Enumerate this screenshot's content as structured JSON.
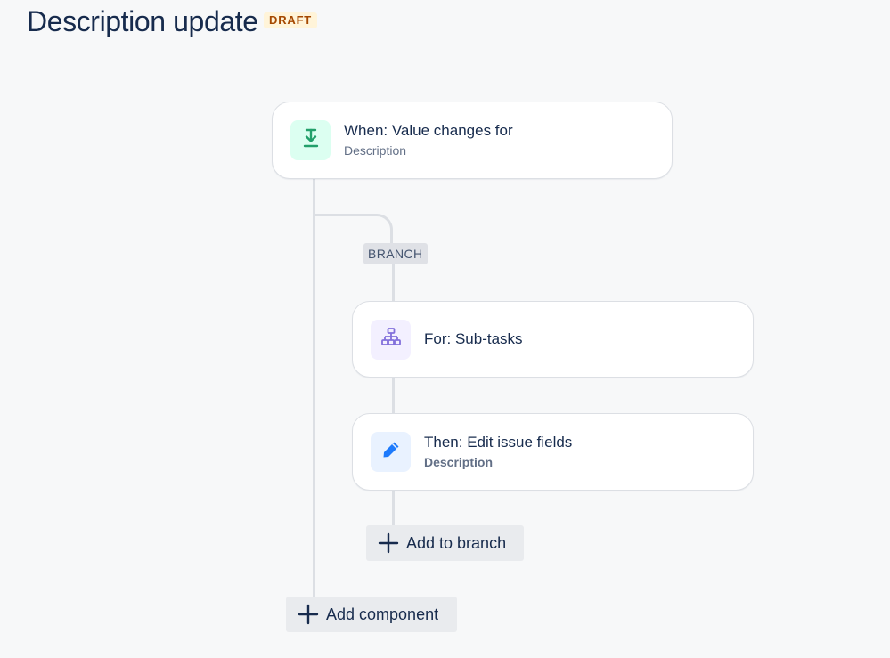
{
  "header": {
    "title": "Description update",
    "status_badge": "DRAFT"
  },
  "flow": {
    "trigger": {
      "title": "When: Value changes for",
      "subtitle": "Description",
      "icon": "download-arrow-icon",
      "icon_color": "#22a06b",
      "icon_bg": "#dcfff1"
    },
    "branch": {
      "label": "BRANCH",
      "condition": {
        "title": "For: Sub-tasks",
        "icon": "hierarchy-icon",
        "icon_color": "#8270db",
        "icon_bg": "#f3f0ff"
      },
      "action": {
        "title": "Then: Edit issue fields",
        "subtitle": "Description",
        "icon": "pencil-icon",
        "icon_color": "#1d7afc",
        "icon_bg": "#e9f2ff"
      },
      "add_button_label": "Add to branch"
    },
    "add_component_label": "Add component"
  }
}
